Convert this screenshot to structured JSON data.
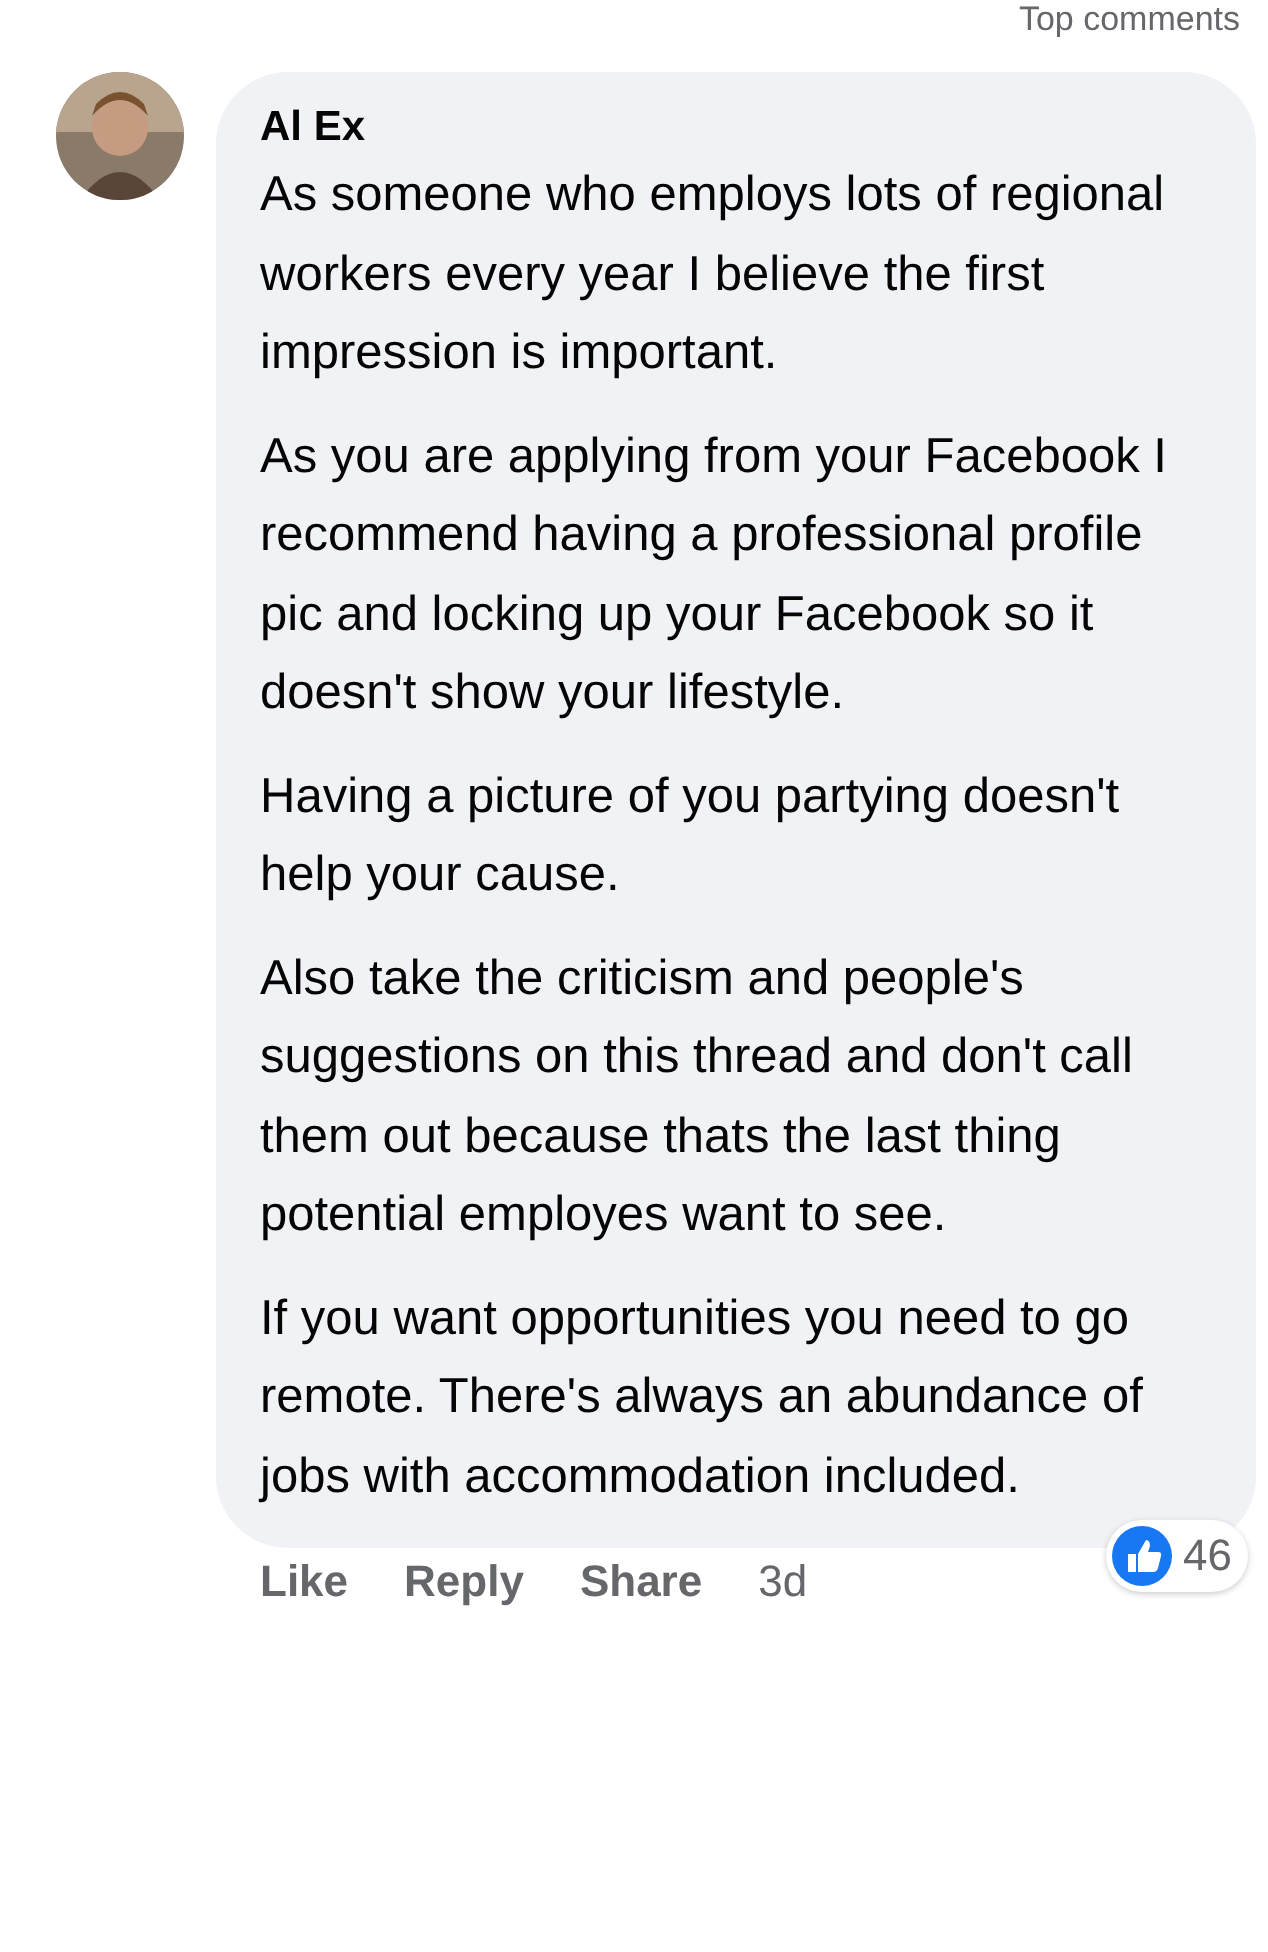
{
  "header": {
    "sort_label": "Top comments"
  },
  "comment": {
    "author": "Al Ex",
    "paragraphs": [
      "As someone who employs lots of regional workers every year I believe the first impression is important.",
      "As you are applying from your Facebook I recommend having a professional profile pic and locking up your Facebook so it doesn't show your lifestyle.",
      "Having a picture of you partying doesn't help your cause.",
      "Also take the criticism and people's suggestions on this thread and don't call them out because thats the last thing potential employes want to see.",
      "If you want opportunities you need to go remote. There's always an abundance of jobs with accommodation included."
    ],
    "reactions": {
      "count": "46"
    },
    "actions": [
      "Like",
      "Reply",
      "Share"
    ],
    "time": "3d"
  }
}
